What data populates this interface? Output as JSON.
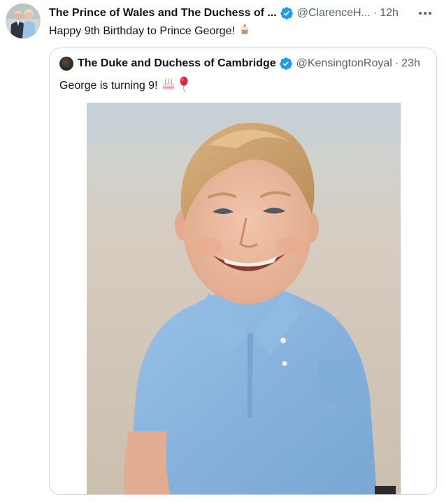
{
  "tweet": {
    "author_name": "The Prince of Wales and The Duchess of ...",
    "handle": "@ClarenceH...",
    "separator": "·",
    "time": "12h",
    "text": "Happy 9th Birthday to Prince George!",
    "emoji": "cupcake-icon"
  },
  "quoted_tweet": {
    "author_name": "The Duke and Duchess of Cambridge",
    "handle": "@KensingtonRoyal",
    "separator": "·",
    "time": "23h",
    "text": "George is turning 9!",
    "emojis": [
      "birthday-cake-icon",
      "balloon-icon"
    ]
  },
  "colors": {
    "verified": "#1d9bf0",
    "secondary_text": "#536471",
    "border": "#cfd9de"
  }
}
